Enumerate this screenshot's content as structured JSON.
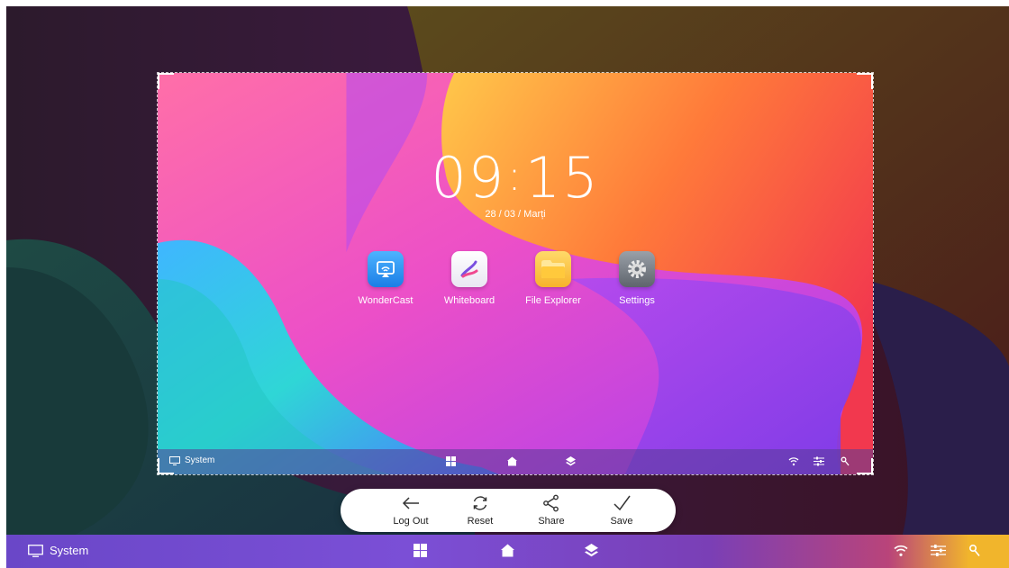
{
  "preview": {
    "clock": {
      "hours": "09",
      "separator": ":",
      "minutes": "15"
    },
    "date": "28 / 03 / Marți",
    "apps": [
      {
        "label": "WonderCast",
        "icon": "wondercast-icon"
      },
      {
        "label": "Whiteboard",
        "icon": "whiteboard-icon"
      },
      {
        "label": "File Explorer",
        "icon": "folder-icon"
      },
      {
        "label": "Settings",
        "icon": "gear-icon"
      }
    ],
    "taskbar": {
      "system_label": "System"
    }
  },
  "toolbar": {
    "buttons": [
      {
        "label": "Log Out",
        "icon": "arrow-left-icon"
      },
      {
        "label": "Reset",
        "icon": "refresh-icon"
      },
      {
        "label": "Share",
        "icon": "share-icon"
      },
      {
        "label": "Save",
        "icon": "checkmark-icon"
      }
    ]
  },
  "taskbar": {
    "system_label": "System",
    "icons": [
      "grid-icon",
      "home-icon",
      "layers-icon",
      "wifi-icon",
      "sliders-icon",
      "pin-icon"
    ]
  },
  "colors": {
    "taskbar_purple": "#6a47c8",
    "accent_yellow": "#f1b52c",
    "accent_pink": "#f04a8f"
  }
}
